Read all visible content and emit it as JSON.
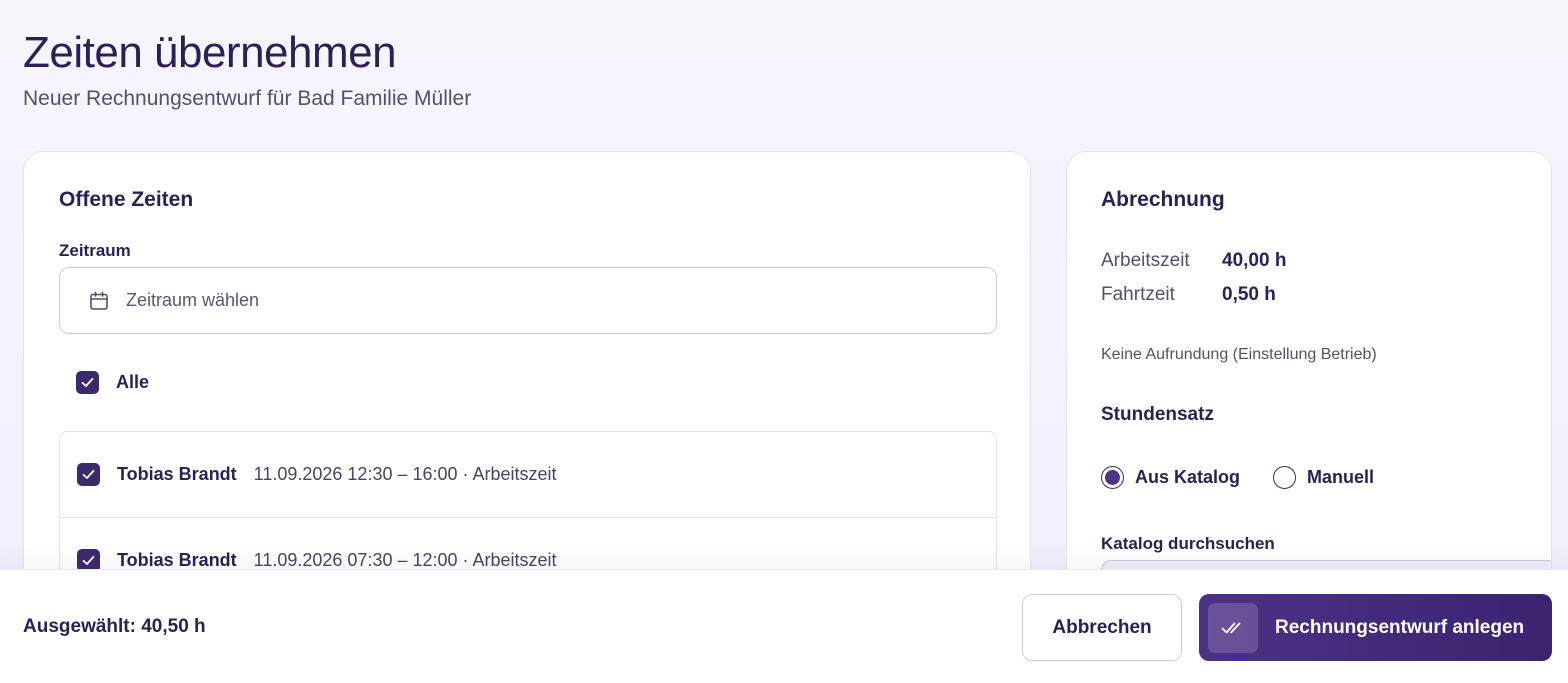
{
  "header": {
    "title": "Zeiten übernehmen",
    "subtitle": "Neuer Rechnungsentwurf für Bad Familie Müller"
  },
  "open_times": {
    "title": "Offene Zeiten",
    "period_label": "Zeitraum",
    "period_placeholder": "Zeitraum wählen",
    "all_label": "Alle",
    "all_checked": true,
    "entries": [
      {
        "name": "Tobias Brandt",
        "detail": "11.09.2026 12:30 – 16:00 · Arbeitszeit",
        "checked": true
      },
      {
        "name": "Tobias Brandt",
        "detail": "11.09.2026 07:30 – 12:00 · Arbeitszeit",
        "checked": true
      }
    ]
  },
  "billing": {
    "title": "Abrechnung",
    "work_label": "Arbeitszeit",
    "work_value": "40,00 h",
    "travel_label": "Fahrtzeit",
    "travel_value": "0,50 h",
    "rounding_note": "Keine Aufrundung (Einstellung Betrieb)",
    "rate_label": "Stundensatz",
    "rate_options": [
      {
        "label": "Aus Katalog",
        "checked": true
      },
      {
        "label": "Manuell",
        "checked": false
      }
    ],
    "catalog_label": "Katalog durchsuchen"
  },
  "footer": {
    "selected": "Ausgewählt: 40,50 h",
    "cancel_label": "Abbrechen",
    "create_label": "Rechnungsentwurf anlegen"
  },
  "colors": {
    "accent": "#3c2a6d",
    "primary_button": "#4c3287"
  },
  "icons": {
    "period": "calendar-icon",
    "checkbox": "check-icon",
    "create": "double-check-icon"
  }
}
